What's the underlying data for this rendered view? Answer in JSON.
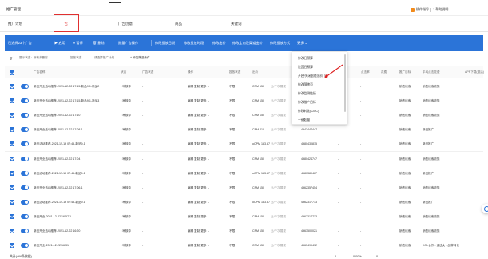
{
  "app": {
    "title": "推广管理",
    "tip_label": "操作指导",
    "tip_hint": "1 帮助说明"
  },
  "tabs": [
    {
      "label": "推广计划"
    },
    {
      "label": "广告"
    },
    {
      "label": "广告创意"
    },
    {
      "label": "商品"
    },
    {
      "label": "关键词"
    }
  ],
  "date_range": {
    "value": "2021-12-22 至 2021-12-22"
  },
  "toolbar": {
    "selected_summary": "已选择23个广告",
    "enable": "▶ 启用",
    "pause": "⏸ 暂停",
    "delete": "🗑 删除",
    "batch_edit": "批量广告操作",
    "item1": "修改投放日期",
    "item2": "修改投放时段",
    "item3": "修改出价",
    "item4": "修改定向及渠道出价",
    "item5": "修改投放方式",
    "more": "更多 ⌄"
  },
  "filter": {
    "chip1": "展示状态：所有未删除 ⌄",
    "chip2": "投放状态 ⌄",
    "chip3": "请选择推广计划 ⌄",
    "add_filter": "+ 添加筛选条件"
  },
  "columns": {
    "name": "广告名称",
    "status": "状态",
    "review": "广告状态",
    "op": "操作",
    "audit": "投放状态",
    "bid": "出价",
    "budget": "预算/日",
    "imp": "展现量",
    "clicks": "点击量",
    "ctr": "点击率",
    "cost": "花费",
    "cpc": "平均点击花费",
    "platform": "推广目标",
    "app": "APP下载(激活)"
  },
  "rows": [
    {
      "name": "新品开业活动推荐-2021-12-22 17:15-新品9-1-新品2",
      "status": "• 审核中",
      "review": "-",
      "op": "编辑  复制  更多 ⌄",
      "audit": "不限",
      "bid": "CPM 150",
      "bid_note": "元/千次展现",
      "budget": "",
      "id": "",
      "imp": "-",
      "clicks": "-",
      "platform": "销售线索",
      "target": "销售线索收集"
    },
    {
      "name": "新品开业活动推荐-2021-12-22 17:15-新品9-1-新品3",
      "status": "• 审核中",
      "review": "-",
      "op": "编辑  复制  更多 ⌄",
      "audit": "不限",
      "bid": "CPM 150",
      "bid_note": "元/千次展现",
      "budget": "",
      "id": "",
      "imp": "-",
      "clicks": "-",
      "platform": "销售线索",
      "target": "销售线索收集"
    },
    {
      "name": "新品开业活动推荐-2021-12-22 17:10",
      "status": "• 审核中",
      "review": "-",
      "op": "编辑  复制  更多 ⌄",
      "audit": "不限",
      "bid": "CPM 150",
      "bid_note": "元/千次展现",
      "budget": "",
      "id": "",
      "imp": "-",
      "clicks": "-",
      "platform": "销售线索",
      "target": "销售线索收集"
    },
    {
      "name": "新品开业活动推荐-2021-12-22 17:08-1",
      "status": "• 审核中",
      "review": "-",
      "op": "编辑  复制  更多 ⌄",
      "audit": "不限",
      "bid": "CPM 210",
      "bid_note": "元/千次展现",
      "budget": "",
      "id": "4643447447",
      "imp": "-",
      "clicks": "-",
      "platform": "销售线索",
      "target": "新品推广"
    },
    {
      "name": "新品活动推荐-2021-12-19 07:45-新品9-1",
      "status": "• 审核中",
      "review": "-",
      "op": "编辑  复制  更多 ⌄",
      "audit": "不限",
      "bid": "oCPM 183.87",
      "bid_note": "元/千次展现",
      "budget": "",
      "id": "4680430815",
      "imp": "-",
      "clicks": "-",
      "platform": "销售线索",
      "target": "新品推广"
    },
    {
      "name": "新品开业活动推荐-2021-12-22 17:04",
      "status": "• 审核中",
      "review": "-",
      "op": "编辑  复制  更多 ⌄",
      "audit": "不限",
      "bid": "CPM 150",
      "bid_note": "元/千次展现",
      "budget": "",
      "id": "4680424747",
      "imp": "-",
      "clicks": "-",
      "platform": "销售线索",
      "target": "销售线索收集"
    },
    {
      "name": "新品活动推荐-2021-12-19 07:45-新品9-1",
      "status": "• 审核中",
      "review": "-",
      "op": "编辑  复制  更多 ⌄",
      "audit": "不限",
      "bid": "oCPM 183.87",
      "bid_note": "元/千次展现",
      "budget": "",
      "id": "4680380467",
      "imp": "-",
      "clicks": "-",
      "platform": "销售线索",
      "target": "新品推广"
    },
    {
      "name": "新品开业活动推荐-2021-12-22 17:06-1",
      "status": "• 审核中",
      "review": "-",
      "op": "编辑  复制  更多 ⌄",
      "audit": "不限",
      "bid": "CPM 150",
      "bid_note": "元/千次展现",
      "budget": "",
      "id": "4662357454",
      "imp": "-",
      "clicks": "-",
      "platform": "销售线索",
      "target": "销售线索收集"
    },
    {
      "name": "新品活动推荐-2021-12-19 07:45-新品9-1",
      "status": "• 审核中",
      "review": "-",
      "op": "编辑  复制  更多 ⌄",
      "audit": "不限",
      "bid": "oCPM 183.87",
      "bid_note": "元/千次展现",
      "budget": "",
      "id": "4662317713",
      "imp": "-",
      "clicks": "-",
      "platform": "销售线索",
      "target": "新品推广"
    },
    {
      "name": "新品开业-2021-12-22 16:57-1",
      "status": "• 审核中",
      "review": "-",
      "op": "编辑  复制  更多 ⌄",
      "audit": "不限",
      "bid": "CPM 150",
      "bid_note": "元/千次展现",
      "budget": "",
      "id": "4662317713",
      "imp": "-",
      "clicks": "-",
      "platform": "销售线索",
      "target": "销售线索收集"
    },
    {
      "name": "新品开业活动推荐-2021-12-22 16:20",
      "status": "• 审核中",
      "review": "-",
      "op": "编辑  复制  更多 ⌄",
      "audit": "不限",
      "bid": "CPM 150",
      "bid_note": "元/千次展现",
      "budget": "",
      "id": "4663500021",
      "imp": "-",
      "clicks": "-",
      "platform": "销售线索",
      "target": "销售线索收集"
    },
    {
      "name": "新品开业-2021-12-22 16:31",
      "status": "• 审核中",
      "review": "-",
      "op": "编辑  复制  更多 ⌄",
      "audit": "不限",
      "bid": "CPM 150",
      "bid_note": "元/千次展现",
      "budget": "",
      "id": "4663499412",
      "imp": "-",
      "clicks": "-",
      "platform": "销售线索",
      "target": "KOL合作 - 通过女 - 品牌转化"
    }
  ],
  "footer": {
    "total_label": "共计(466条数据)",
    "impr": "0",
    "ctr": "0.00%",
    "cost": "0"
  },
  "dropdown": {
    "items": [
      "修改日预算",
      "设置日预算",
      "开启/关闭智能出价 ⊙",
      "修改落地页",
      "修改监测链接",
      "修改推广目标",
      "修改转化(CMC)",
      "一键起量"
    ]
  }
}
